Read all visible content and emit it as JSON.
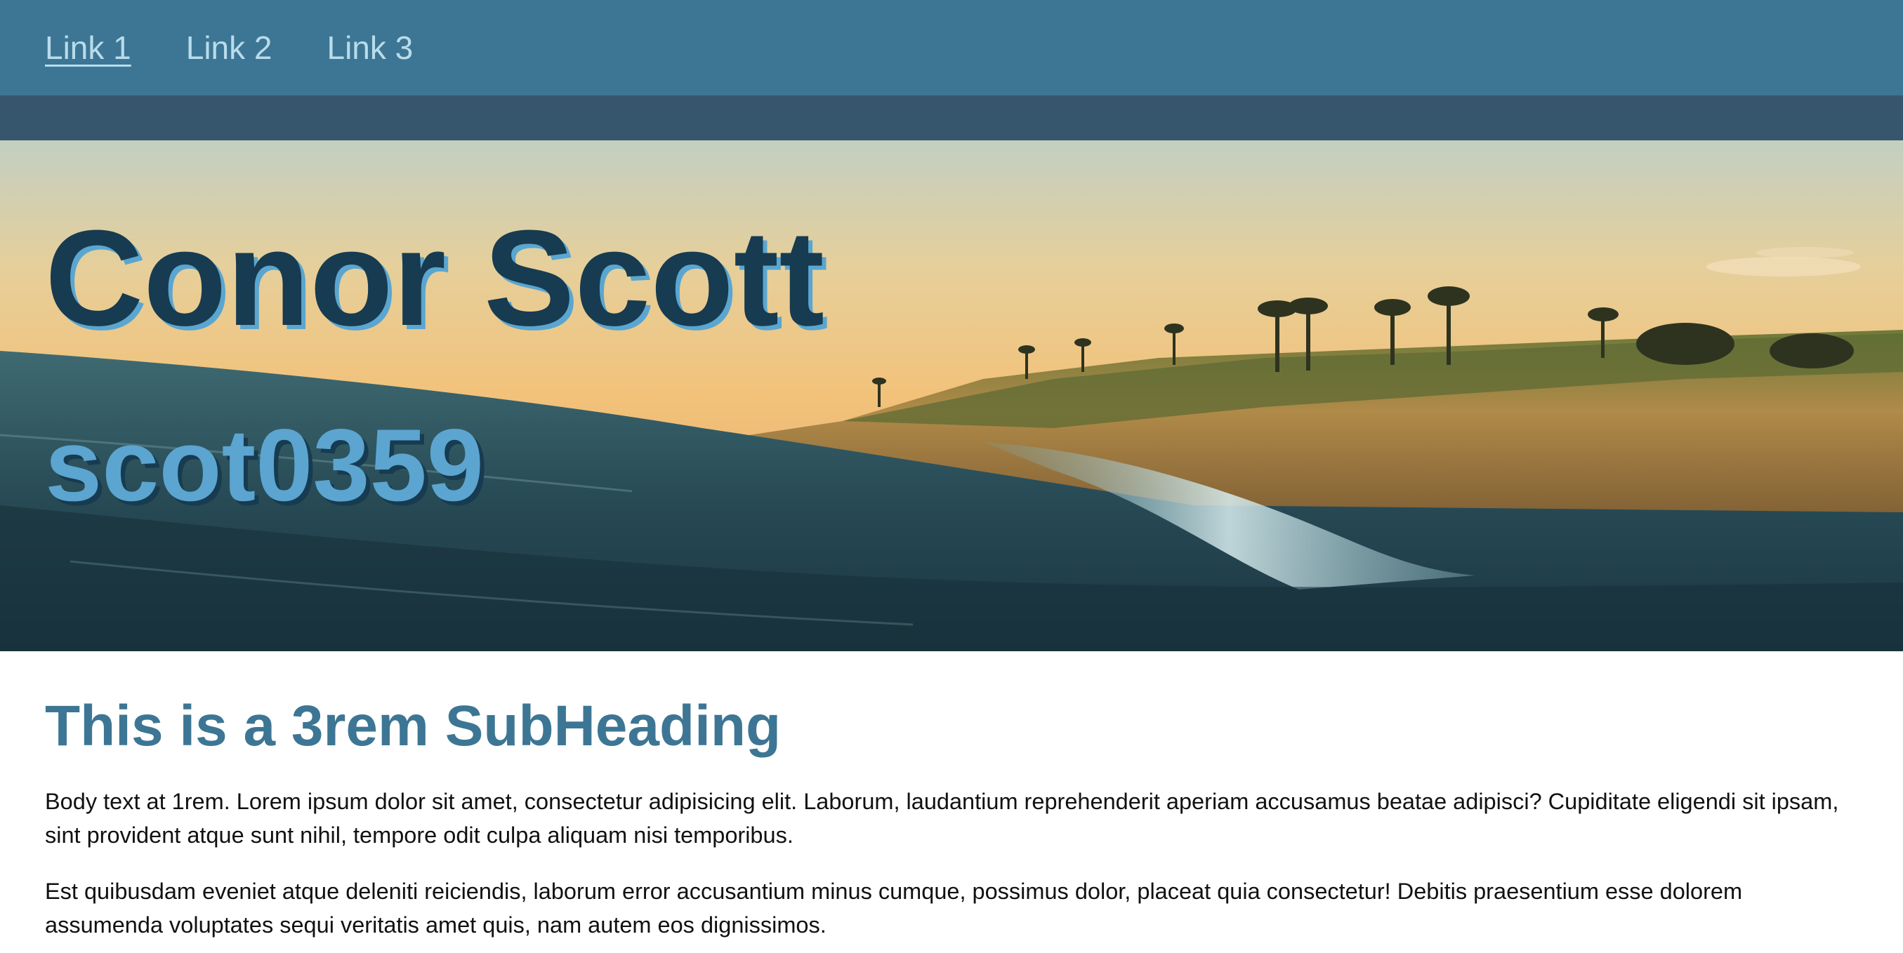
{
  "nav": {
    "links": [
      "Link 1",
      "Link 2",
      "Link 3"
    ]
  },
  "hero": {
    "title": "Conor Scott",
    "subtitle": "scot0359",
    "image": "beach sunset with breaking ocean wave, sandy cliffs and palm trees"
  },
  "main": {
    "subheading": "This is a 3rem SubHeading",
    "paragraphs": [
      "Body text at 1rem. Lorem ipsum dolor sit amet, consectetur adipisicing elit. Laborum, laudantium reprehenderit aperiam accusamus beatae adipisci? Cupiditate eligendi sit ipsam, sint provident atque sunt nihil, tempore odit culpa aliquam nisi temporibus.",
      "Est quibusdam eveniet atque deleniti reiciendis, laborum error accusantium minus cumque, possimus dolor, placeat quia consectetur! Debitis praesentium esse dolorem assumenda voluptates sequi veritatis amet quis, nam autem eos dignissimos."
    ]
  },
  "colors": {
    "nav_bg": "#3d7694",
    "subbar_bg": "#36566d",
    "title": "#173b50",
    "accent": "#5ba5d0",
    "link": "#b9dceb"
  }
}
